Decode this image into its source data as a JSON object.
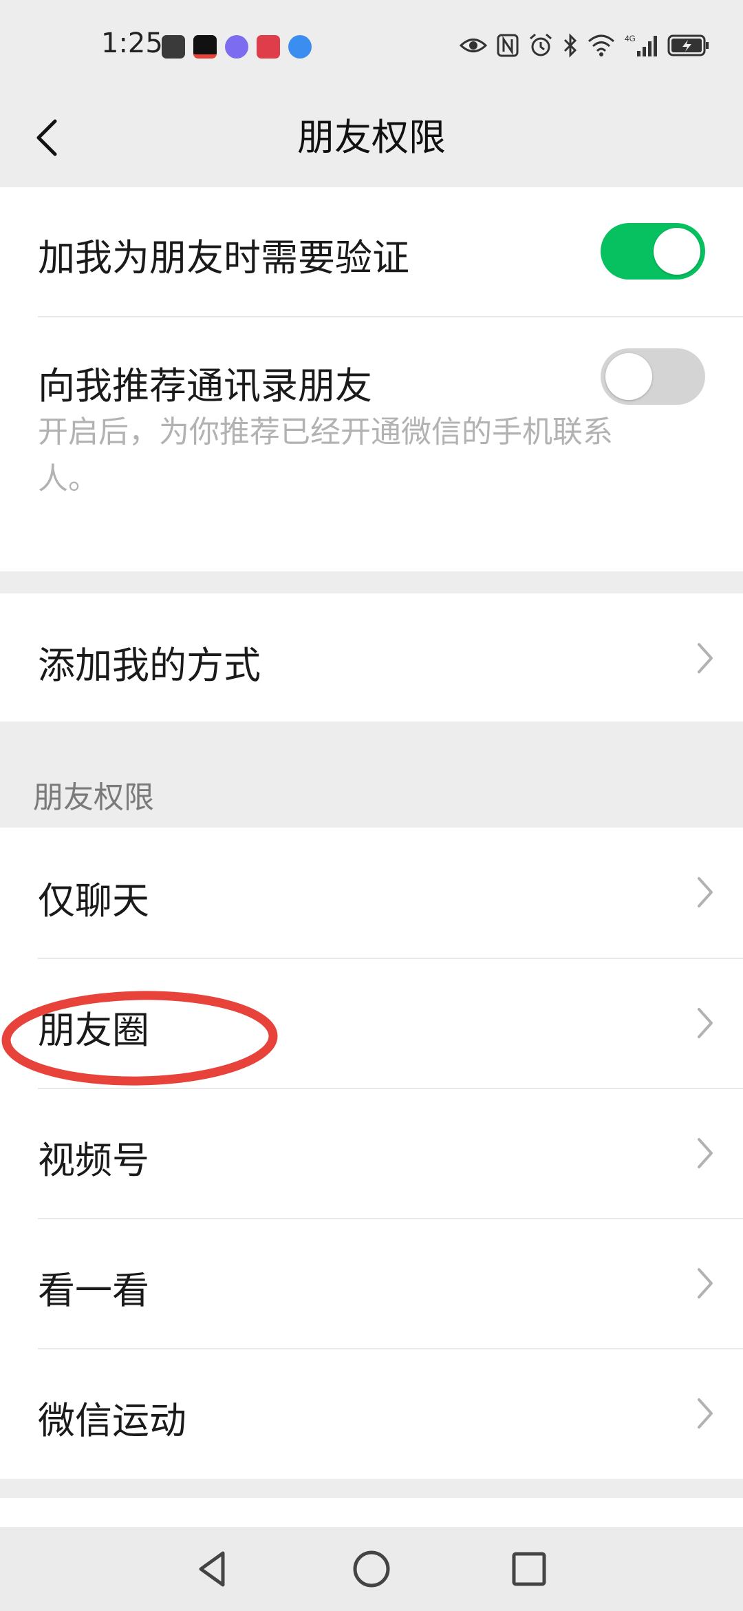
{
  "status_bar": {
    "time": "1:25",
    "notification_icons": [
      "huawei-appgallery-icon",
      "tiktok-icon",
      "music-icon",
      "book-icon",
      "browser-icon"
    ],
    "system_icons": [
      "eye-icon",
      "nfc-icon",
      "alarm-icon",
      "bluetooth-icon",
      "wifi-icon",
      "signal-4g-icon",
      "battery-charging-icon"
    ],
    "network": "4G"
  },
  "nav": {
    "title": "朋友权限",
    "back_icon": "chevron-left-icon"
  },
  "settings_group_1": {
    "verify": {
      "label": "加我为朋友时需要验证",
      "toggle": "on"
    },
    "recommend": {
      "label": "向我推荐通讯录朋友",
      "toggle": "off",
      "description_line1": "开启后，为你推荐已经开通微信的手机联系",
      "description_line2": "人。"
    }
  },
  "settings_group_2": {
    "add_methods": {
      "label": "添加我的方式"
    }
  },
  "section_title": "朋友权限",
  "permission_items": [
    {
      "label": "仅聊天"
    },
    {
      "label": "朋友圈"
    },
    {
      "label": "视频号"
    },
    {
      "label": "看一看"
    },
    {
      "label": "微信运动"
    }
  ],
  "colors": {
    "accent_green": "#07c160",
    "annotation_red": "#e8433a",
    "background": "#ededed"
  },
  "android_nav": [
    "back-triangle-icon",
    "home-circle-icon",
    "recents-square-icon"
  ]
}
